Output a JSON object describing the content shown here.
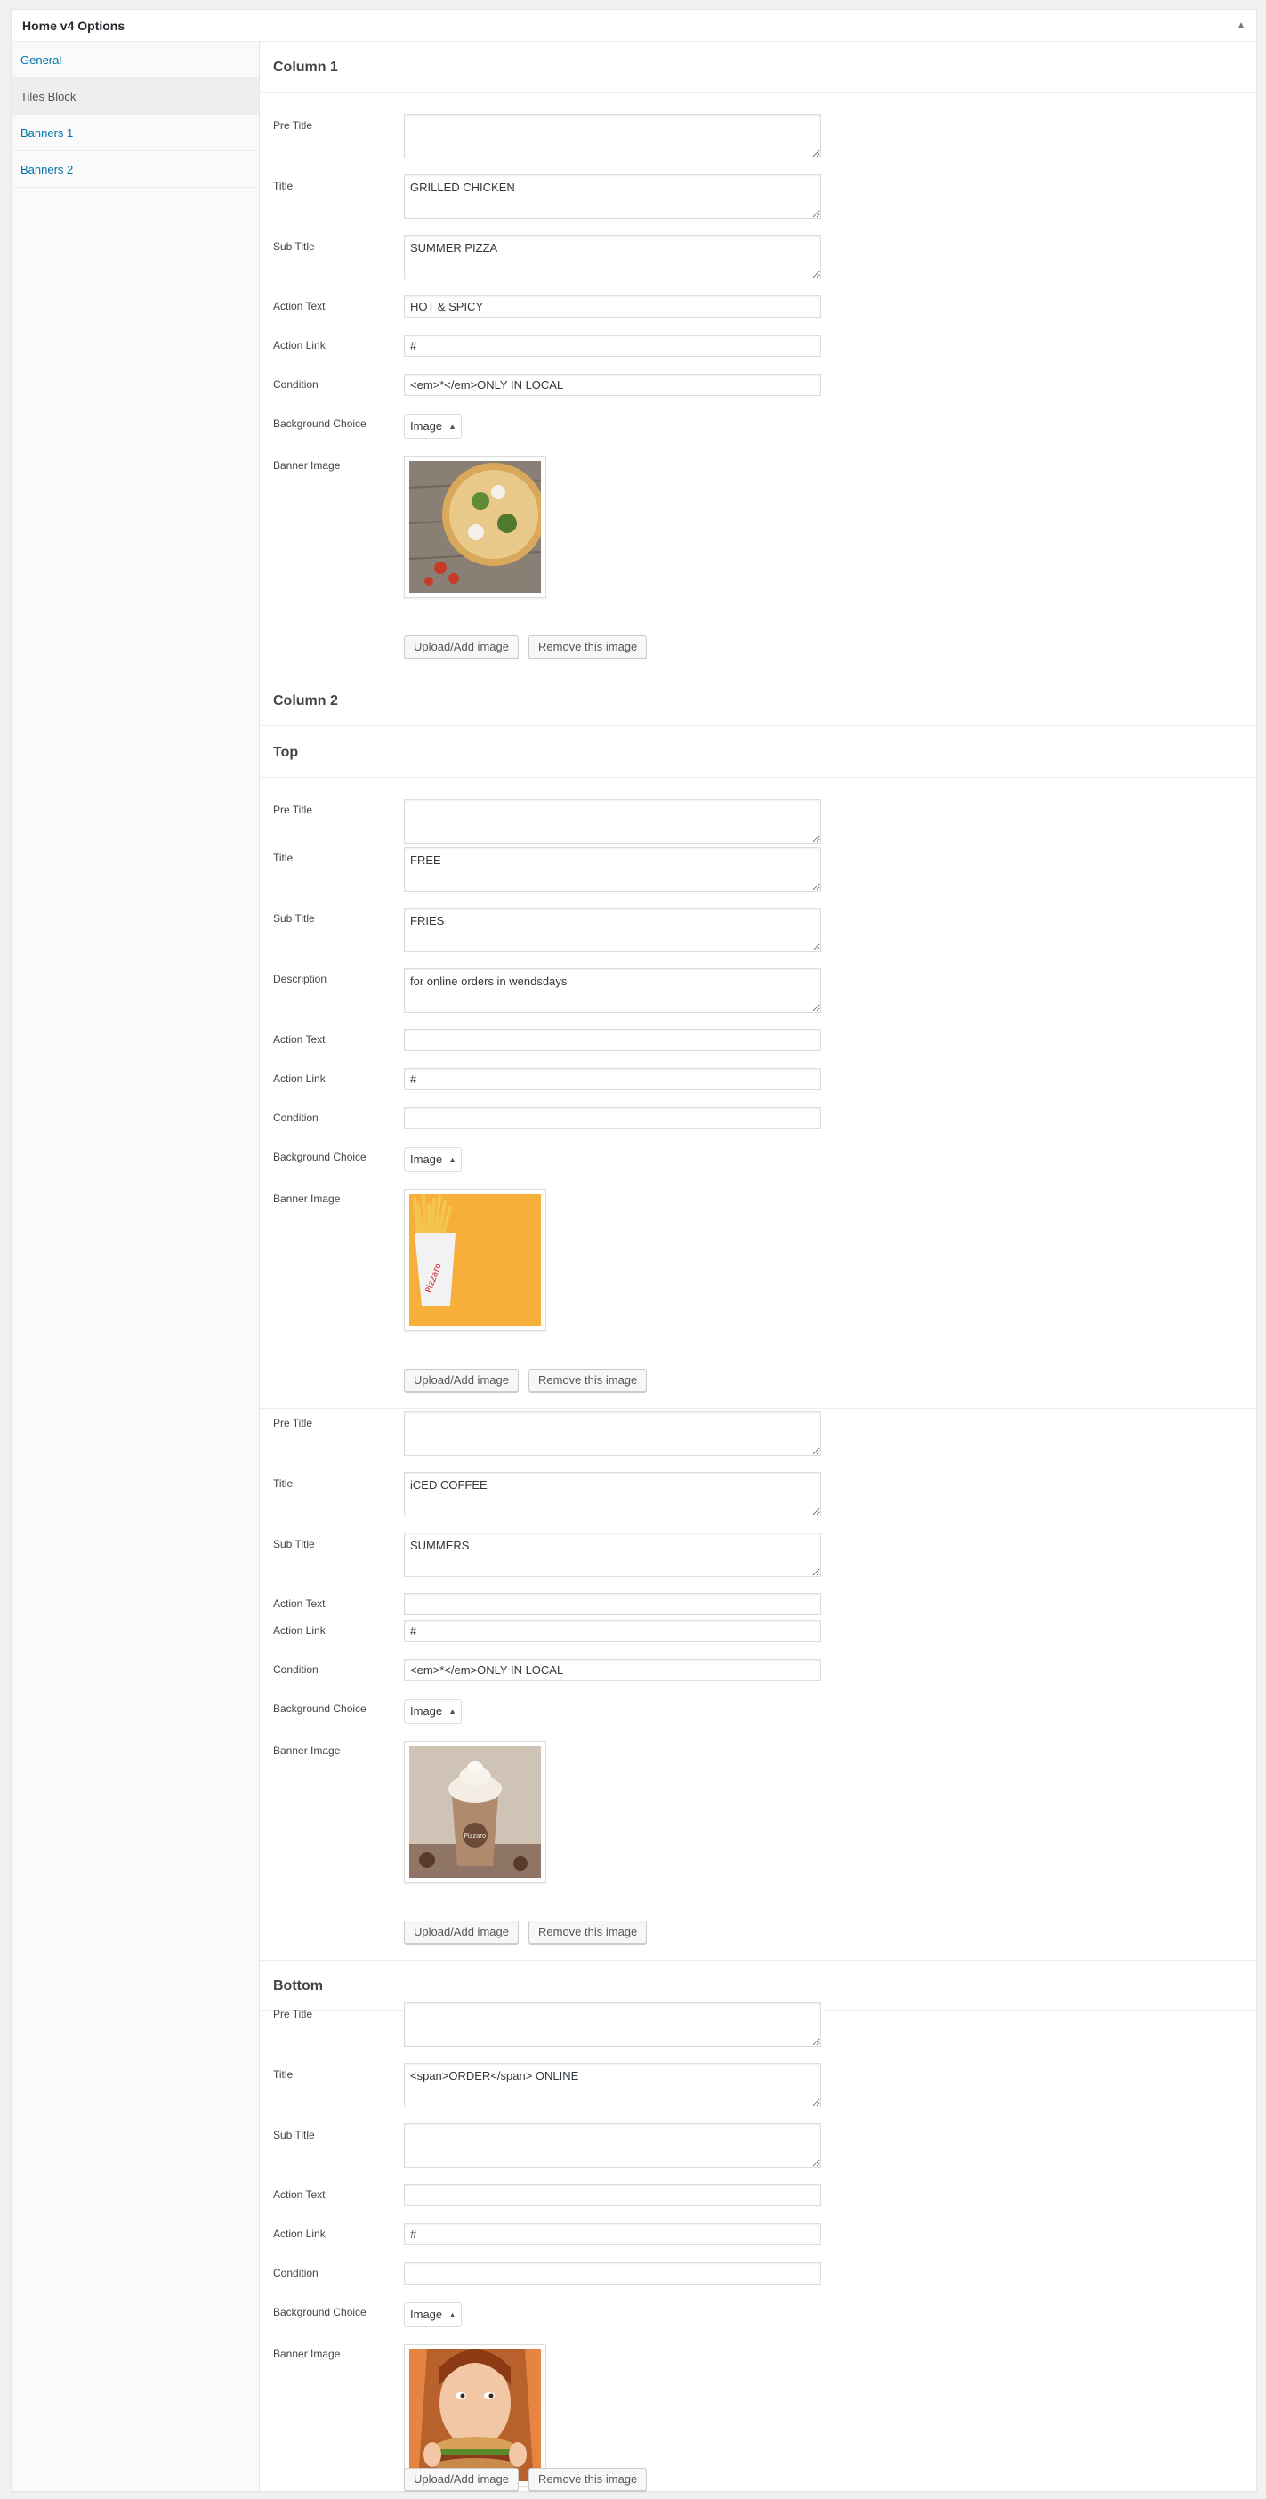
{
  "panel": {
    "title": "Home v4 Options"
  },
  "sidebar": {
    "items": [
      {
        "label": "General"
      },
      {
        "label": "Tiles Block"
      },
      {
        "label": "Banners 1"
      },
      {
        "label": "Banners 2"
      }
    ]
  },
  "labels": {
    "pre_title": "Pre Title",
    "title": "Title",
    "sub_title": "Sub Title",
    "description": "Description",
    "action_text": "Action Text",
    "action_link": "Action Link",
    "condition": "Condition",
    "background_choice": "Background Choice",
    "banner_image": "Banner Image"
  },
  "buttons": {
    "upload": "Upload/Add image",
    "remove": "Remove this image"
  },
  "column1": {
    "heading": "Column 1",
    "pre_title": "",
    "title": "GRILLED CHICKEN",
    "sub_title": "SUMMER PIZZA",
    "action_text": "HOT & SPICY",
    "action_link": "#",
    "condition": "<em>*</em>ONLY IN LOCAL",
    "background_choice": "Image"
  },
  "column2": {
    "heading": "Column 2",
    "top_heading": "Top",
    "top": {
      "pre_title": "",
      "title": "FREE",
      "sub_title": "FRIES",
      "description": "for online orders in wendsdays",
      "action_text": "",
      "action_link": "#",
      "condition": "",
      "background_choice": "Image"
    },
    "second": {
      "pre_title": "",
      "title": "iCED COFFEE",
      "sub_title": "SUMMERS",
      "action_text": "",
      "action_link": "#",
      "condition": "<em>*</em>ONLY IN LOCAL",
      "background_choice": "Image"
    },
    "bottom_heading": "Bottom",
    "bottom": {
      "pre_title": "",
      "title": "<span>ORDER</span> ONLINE",
      "sub_title": "",
      "action_text": "",
      "action_link": "#",
      "condition": "",
      "background_choice": "Image"
    }
  }
}
